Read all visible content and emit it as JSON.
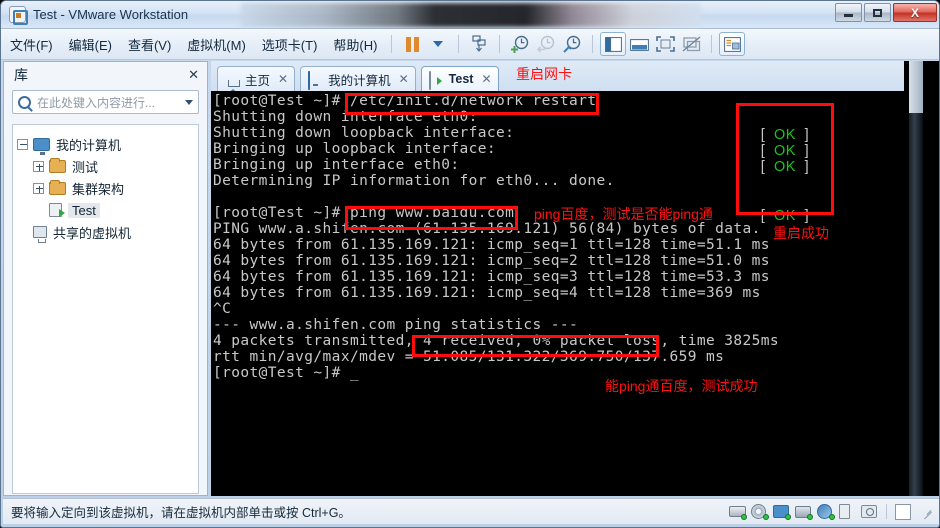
{
  "window": {
    "title": "Test - VMware Workstation",
    "app_icon": "vmware-logo-icon",
    "minimize_label": "最小化",
    "maximize_label": "最大化",
    "close_label": "关闭",
    "close_glyph": "X"
  },
  "menu": {
    "items": [
      {
        "label": "文件(F)"
      },
      {
        "label": "编辑(E)"
      },
      {
        "label": "查看(V)"
      },
      {
        "label": "虚拟机(M)"
      },
      {
        "label": "选项卡(T)"
      },
      {
        "label": "帮助(H)"
      }
    ]
  },
  "toolbar": {
    "buttons": [
      {
        "name": "pause-button",
        "tip": "暂停"
      },
      {
        "name": "pause-dropdown",
        "tip": "下拉"
      },
      {
        "name": "take-snapshot-button",
        "tip": "拍摄快照"
      },
      {
        "name": "snapshot-add-button",
        "tip": "创建快照"
      },
      {
        "name": "revert-snapshot-button",
        "tip": "恢复快照"
      },
      {
        "name": "snapshot-manager-button",
        "tip": "快照管理器"
      },
      {
        "name": "show-library-button",
        "tip": "显示库"
      },
      {
        "name": "show-console-view-button",
        "tip": "控制台视图"
      },
      {
        "name": "fullscreen-button",
        "tip": "全屏"
      },
      {
        "name": "unity-mode-button",
        "tip": "Unity 模式"
      },
      {
        "name": "show-thumbnail-bar-button",
        "tip": "缩略图栏"
      }
    ]
  },
  "library": {
    "title": "库",
    "close_glyph": "✕",
    "search_placeholder": "在此处键入内容进行...",
    "tree": [
      {
        "label": "我的计算机",
        "icon": "monitor-icon",
        "depth": 0,
        "expander": "minus",
        "selected": false
      },
      {
        "label": "测试",
        "icon": "folder-icon",
        "depth": 1,
        "expander": "plus",
        "selected": false
      },
      {
        "label": "集群架构",
        "icon": "folder-icon",
        "depth": 1,
        "expander": "plus",
        "selected": false
      },
      {
        "label": "Test",
        "icon": "vm-running-icon",
        "depth": 1,
        "expander": "none",
        "selected": true
      },
      {
        "label": "共享的虚拟机",
        "icon": "shared-vm-icon",
        "depth": 0,
        "expander": "none",
        "selected": false
      }
    ]
  },
  "tabs": [
    {
      "label": "主页",
      "icon": "home-icon",
      "active": false,
      "close_glyph": "✕"
    },
    {
      "label": "我的计算机",
      "icon": "monitor-icon",
      "active": false,
      "close_glyph": "✕"
    },
    {
      "label": "Test",
      "icon": "vm-running-icon",
      "active": true,
      "close_glyph": "✕"
    }
  ],
  "terminal": {
    "lines": [
      "[root@Test ~]# /etc/init.d/network restart",
      "Shutting down interface eth0:",
      "Shutting down loopback interface:",
      "Bringing up loopback interface:",
      "Bringing up interface eth0:",
      "Determining IP information for eth0... done.",
      "",
      "[root@Test ~]# ping www.baidu.com",
      "PING www.a.shifen.com (61.135.169.121) 56(84) bytes of data.",
      "64 bytes from 61.135.169.121: icmp_seq=1 ttl=128 time=51.1 ms",
      "64 bytes from 61.135.169.121: icmp_seq=2 ttl=128 time=51.0 ms",
      "64 bytes from 61.135.169.121: icmp_seq=3 ttl=128 time=53.3 ms",
      "64 bytes from 61.135.169.121: icmp_seq=4 ttl=128 time=369 ms",
      "^C",
      "--- www.a.shifen.com ping statistics ---",
      "4 packets transmitted, 4 received, 0% packet loss, time 3825ms",
      "rtt min/avg/max/mdev = 51.085/131.322/369.750/137.659 ms",
      "[root@Test ~]# _"
    ],
    "status_column": [
      {
        "text": "[   OK   ]",
        "ok": "OK"
      },
      {
        "text": "[   OK   ]",
        "ok": "OK"
      },
      {
        "text": "[   OK   ]",
        "ok": "OK"
      },
      {
        "text": "[   OK   ]",
        "ok": "OK"
      }
    ],
    "ok_bracket_left": "[",
    "ok_bracket_right": "]",
    "ok_label": "OK"
  },
  "annotations": [
    {
      "name": "annotation-restart-nic",
      "text": "重启网卡"
    },
    {
      "name": "annotation-ping-baidu",
      "text": "ping百度，测试是否能ping通"
    },
    {
      "name": "annotation-restart-success",
      "text": "重启成功"
    },
    {
      "name": "annotation-ping-success",
      "text": "能ping通百度，测试成功"
    }
  ],
  "statusbar": {
    "message": "要将输入定向到该虚拟机，请在虚拟机内部单击或按 Ctrl+G。",
    "devices": [
      {
        "name": "hard-disk-icon"
      },
      {
        "name": "cd-dvd-icon"
      },
      {
        "name": "network-adapter-icon"
      },
      {
        "name": "printer-icon"
      },
      {
        "name": "sound-card-icon"
      },
      {
        "name": "usb-icon"
      },
      {
        "name": "camera-icon"
      },
      {
        "name": "notes-icon"
      }
    ]
  },
  "colors": {
    "accent": "#3f7fb8",
    "annotation_red": "#ff1111",
    "terminal_ok_green": "#1ec41e",
    "terminal_fg": "#c8c8c8",
    "terminal_bg": "#000000"
  }
}
